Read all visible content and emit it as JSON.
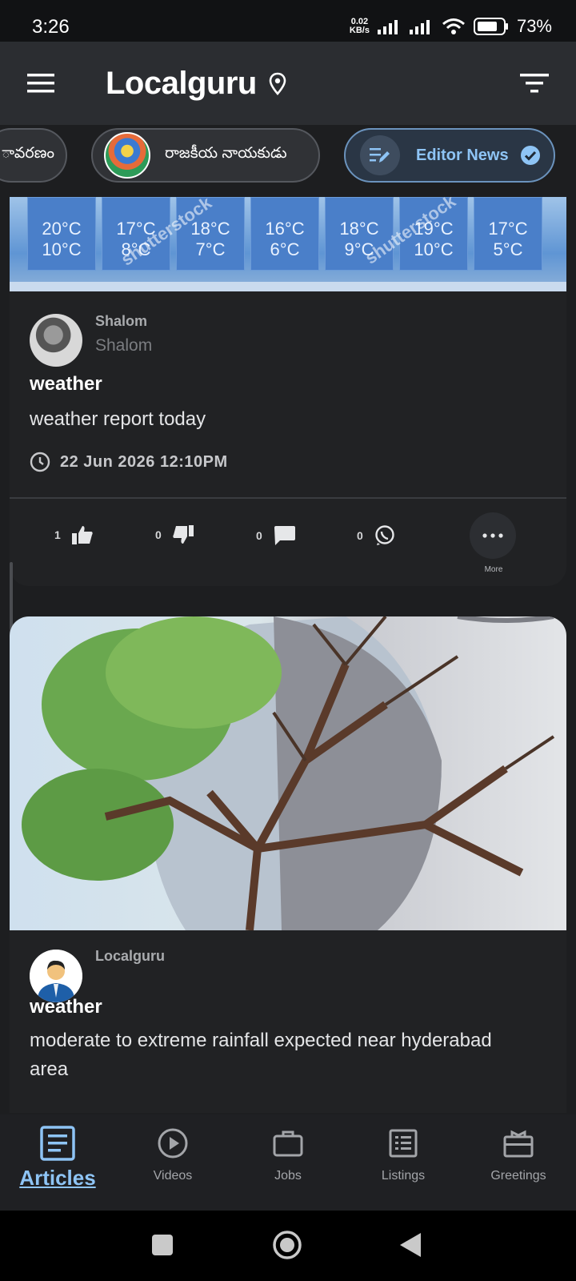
{
  "status_bar": {
    "time": "3:26",
    "net_speed_value": "0.02",
    "net_speed_unit": "KB/s",
    "battery": "73%"
  },
  "header": {
    "title": "Localguru",
    "menu_icon": "hamburger-menu-icon",
    "location_icon": "location-pin-icon",
    "filter_icon": "filter-icon"
  },
  "chips": [
    {
      "label": "ావరణం"
    },
    {
      "label": "రాజకీయ నాయకుడు"
    },
    {
      "label": "Editor News",
      "icon": "edit-note-icon",
      "badge_icon": "verified-check-icon"
    }
  ],
  "weather_tiles": [
    {
      "high": "20°C",
      "low": "10°C"
    },
    {
      "high": "17°C",
      "low": "8°C"
    },
    {
      "high": "18°C",
      "low": "7°C"
    },
    {
      "high": "16°C",
      "low": "6°C"
    },
    {
      "high": "18°C",
      "low": "9°C"
    },
    {
      "high": "19°C",
      "low": "10°C"
    },
    {
      "high": "17°C",
      "low": "5°C"
    }
  ],
  "watermark": "shutterstock",
  "posts": [
    {
      "author": "Shalom",
      "author_sub": "Shalom",
      "title": "weather",
      "body": "weather report today",
      "timestamp": "22 Jun 2026 12:10PM",
      "likes": "1",
      "dislikes": "0",
      "comments": "0",
      "shares": "0",
      "more_label": "More"
    },
    {
      "author": "Localguru",
      "title": "weather",
      "body": "moderate to extreme rainfall expected near hyderabad area"
    }
  ],
  "bottom_nav": [
    {
      "label": "Articles",
      "icon": "articles-icon",
      "active": true
    },
    {
      "label": "Videos",
      "icon": "play-circle-icon"
    },
    {
      "label": "Jobs",
      "icon": "briefcase-icon"
    },
    {
      "label": "Listings",
      "icon": "list-icon"
    },
    {
      "label": "Greetings",
      "icon": "gift-icon"
    }
  ],
  "colors": {
    "accent": "#8ec4f5",
    "background": "#1d1e20",
    "header": "#2b2d31"
  }
}
